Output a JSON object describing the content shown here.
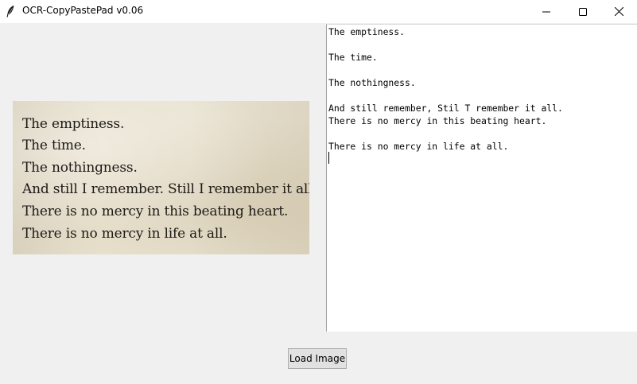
{
  "window": {
    "title": "OCR-CopyPastePad v0.06",
    "icons": {
      "app": "feather-icon",
      "minimize": "minimize-icon",
      "maximize": "maximize-icon",
      "close": "close-icon"
    }
  },
  "image_panel": {
    "lines": [
      "The emptiness.",
      "The time.",
      "The nothingness.",
      "And still I remember. Still I remember it all.",
      "There is no mercy in this beating heart.",
      "There is no mercy in life at all."
    ]
  },
  "text_area": {
    "lines": [
      "The emptiness.",
      "",
      "The time.",
      "",
      "The nothingness.",
      "",
      "And still remember, Stil T remember it all.",
      "There is no mercy in this beating heart.",
      "",
      "There is no mercy in life at all."
    ]
  },
  "buttons": {
    "load_image": "Load Image"
  }
}
